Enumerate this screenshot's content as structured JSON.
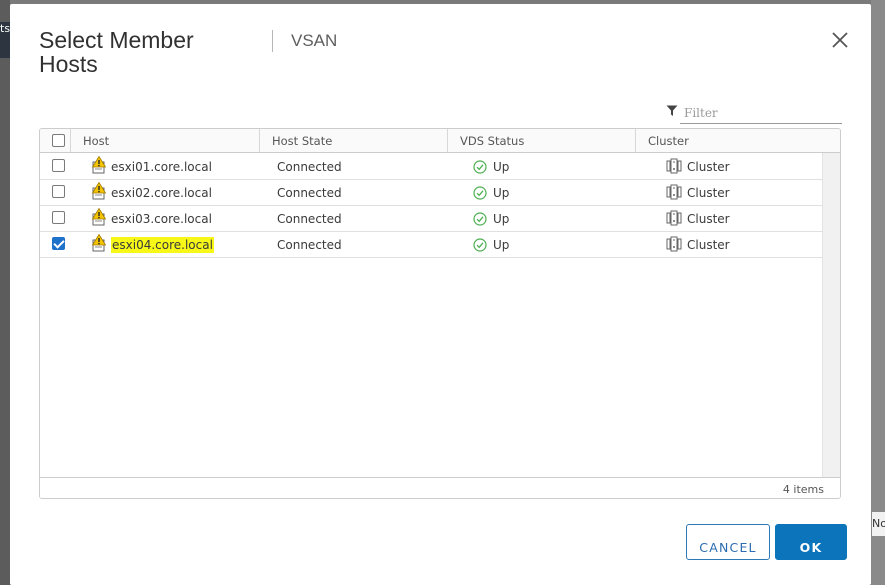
{
  "background": {
    "left_tab_text": "ts",
    "right_field_text": "No"
  },
  "dialog": {
    "title": "Select Member Hosts",
    "subtitle": "VSAN",
    "filter_placeholder": "Filter"
  },
  "grid": {
    "columns": [
      "Host",
      "Host State",
      "VDS Status",
      "Cluster"
    ],
    "rows": [
      {
        "host": "esxi01.core.local",
        "state": "Connected",
        "vds_status": "Up",
        "cluster": "Cluster",
        "checked": false,
        "host_icon": "host-warning-icon",
        "status_icon": "check-circle-icon",
        "cluster_icon": "cluster-icon"
      },
      {
        "host": "esxi02.core.local",
        "state": "Connected",
        "vds_status": "Up",
        "cluster": "Cluster",
        "checked": false,
        "host_icon": "host-warning-icon",
        "status_icon": "check-circle-icon",
        "cluster_icon": "cluster-icon"
      },
      {
        "host": "esxi03.core.local",
        "state": "Connected",
        "vds_status": "Up",
        "cluster": "Cluster",
        "checked": false,
        "host_icon": "host-warning-icon",
        "status_icon": "check-circle-icon",
        "cluster_icon": "cluster-icon"
      },
      {
        "host": "esxi04.core.local",
        "state": "Connected",
        "vds_status": "Up",
        "cluster": "Cluster",
        "checked": true,
        "host_icon": "host-warning-icon",
        "status_icon": "check-circle-icon",
        "cluster_icon": "cluster-icon"
      }
    ],
    "item_count": "4 items"
  },
  "buttons": {
    "cancel": "CANCEL",
    "ok": "OK"
  },
  "colors": {
    "primary": "#0c74ba",
    "checkbox": "#1e72c9",
    "highlight": "#f7f718",
    "warning": "#f5c400",
    "success": "#4caf50"
  }
}
